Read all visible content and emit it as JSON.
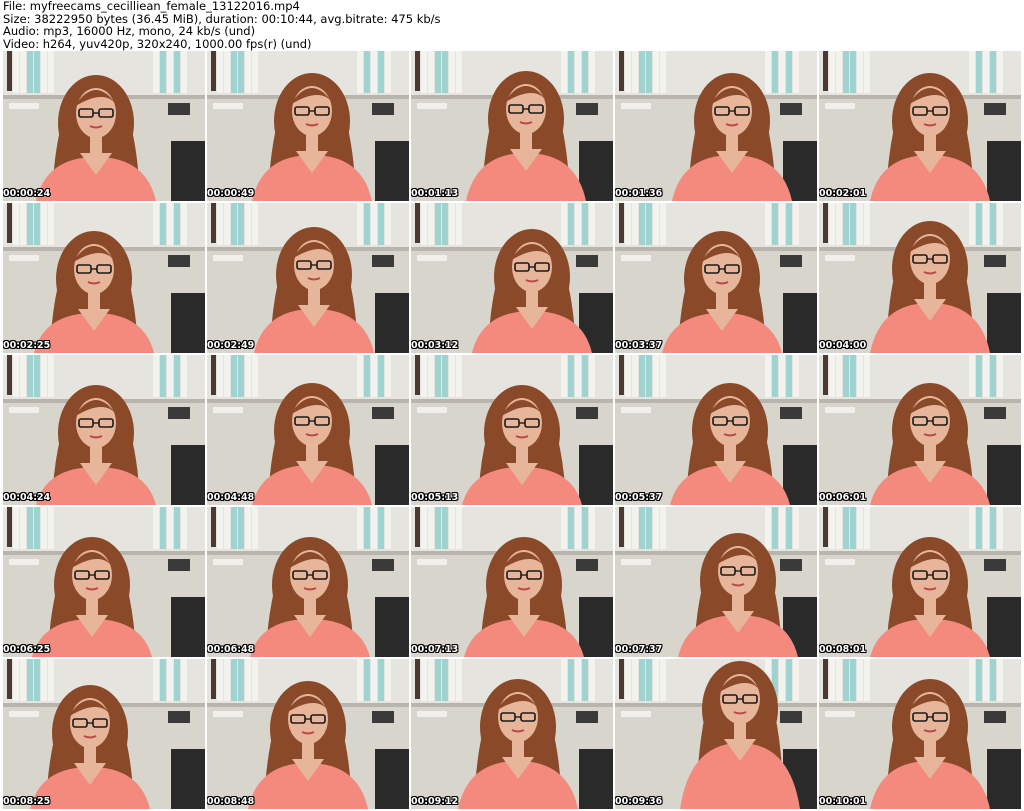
{
  "header": {
    "file_line": "File: myfreecams_cecilliean_female_13122016.mp4",
    "size_line": "Size: 38222950 bytes (36.45 MiB), duration: 00:10:44, avg.bitrate: 475 kb/s",
    "audio_line": "Audio: mp3, 16000 Hz, mono, 24 kb/s (und)",
    "video_line": "Video: h264, yuv420p, 320x240, 1000.00 fps(r) (und)"
  },
  "thumbnails": [
    {
      "timestamp": "00:00:24"
    },
    {
      "timestamp": "00:00:49"
    },
    {
      "timestamp": "00:01:13"
    },
    {
      "timestamp": "00:01:36"
    },
    {
      "timestamp": "00:02:01"
    },
    {
      "timestamp": "00:02:25"
    },
    {
      "timestamp": "00:02:49"
    },
    {
      "timestamp": "00:03:12"
    },
    {
      "timestamp": "00:03:37"
    },
    {
      "timestamp": "00:04:00"
    },
    {
      "timestamp": "00:04:24"
    },
    {
      "timestamp": "00:04:48"
    },
    {
      "timestamp": "00:05:13"
    },
    {
      "timestamp": "00:05:37"
    },
    {
      "timestamp": "00:06:01"
    },
    {
      "timestamp": "00:06:25"
    },
    {
      "timestamp": "00:06:48"
    },
    {
      "timestamp": "00:07:13"
    },
    {
      "timestamp": "00:07:37"
    },
    {
      "timestamp": "00:08:01"
    },
    {
      "timestamp": "00:08:25"
    },
    {
      "timestamp": "00:08:48"
    },
    {
      "timestamp": "00:09:12"
    },
    {
      "timestamp": "00:09:36"
    },
    {
      "timestamp": "00:10:01"
    }
  ],
  "colors": {
    "wall": "#d8d5cd",
    "binder_white": "#f2f2ef",
    "binder_teal": "#9fd3cf",
    "binder_dark": "#4a3a32",
    "hair": "#8a4a2a",
    "skin": "#e7b59a",
    "shirt": "#f48a7e",
    "chair": "#2a2a2a"
  }
}
